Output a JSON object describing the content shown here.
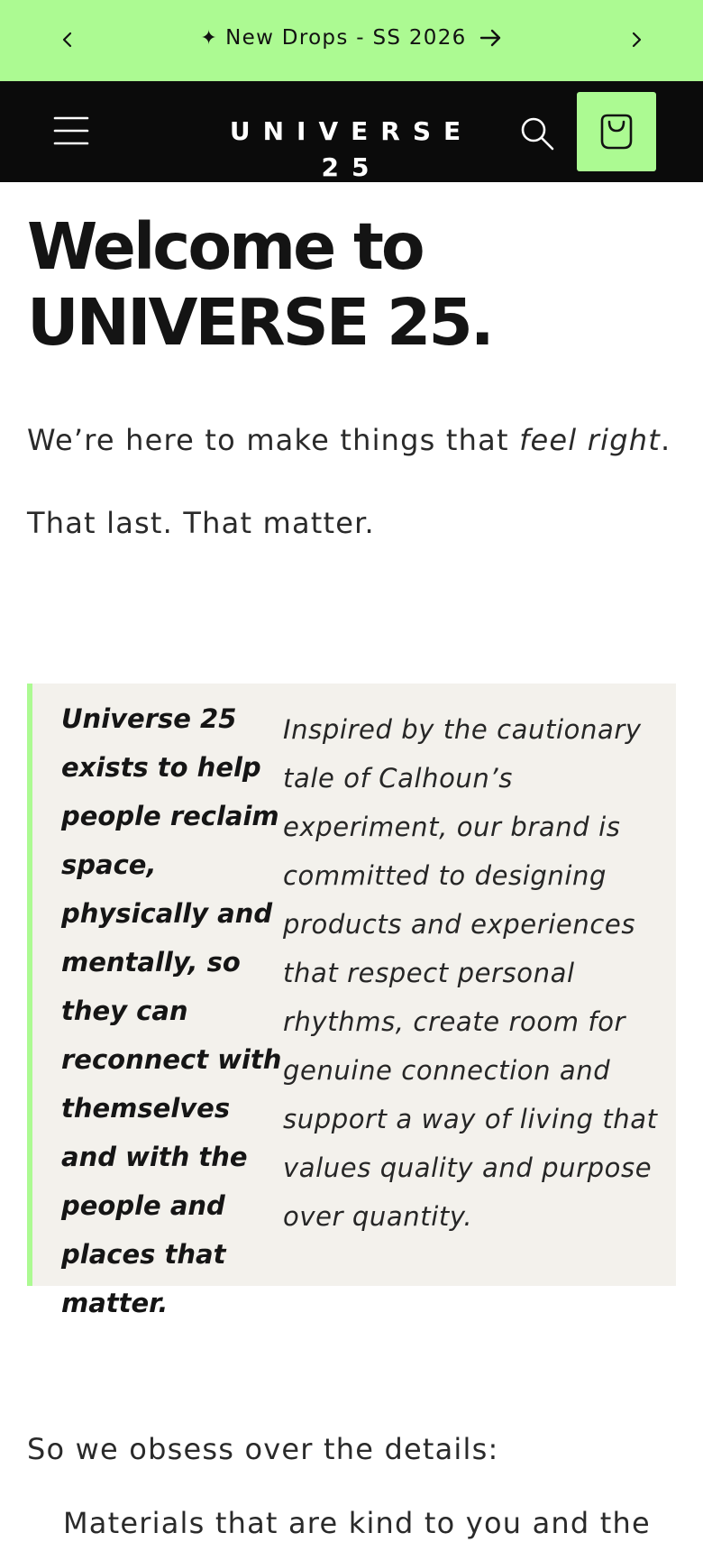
{
  "announcement": {
    "star": "✦",
    "text": "New Drops - SS 2026",
    "background": "#acfa92"
  },
  "header": {
    "logo": "UNIVERSE 25",
    "background": "#0b0b0b",
    "accent": "#acfa92"
  },
  "hero": {
    "title_line1": "Welcome to",
    "title_line2": "UNIVERSE 25."
  },
  "intro": {
    "line1_before": "We’re here to make things that ",
    "line1_em": "feel right",
    "line1_after": ".",
    "line2": "That last. That matter."
  },
  "quote": {
    "left": "Universe 25 exists to help people reclaim space, physically and mentally, so they can reconnect with themselves and with the people and places that matter.",
    "right": "Inspired by the cautionary tale of Calhoun’s experiment, our brand is committed to designing products and experiences that respect personal rhythms, create room for genuine connection and support a way of living that values quality and purpose over quantity."
  },
  "details": {
    "heading": "So we obsess over the details:",
    "first_item_visible": "Materials that are kind to you and the"
  },
  "icons": {
    "prev": "chevron-left-icon",
    "next": "chevron-right-icon",
    "menu": "hamburger-menu-icon",
    "search": "search-icon",
    "cart": "shopping-bag-icon",
    "arrow": "arrow-right-icon"
  }
}
